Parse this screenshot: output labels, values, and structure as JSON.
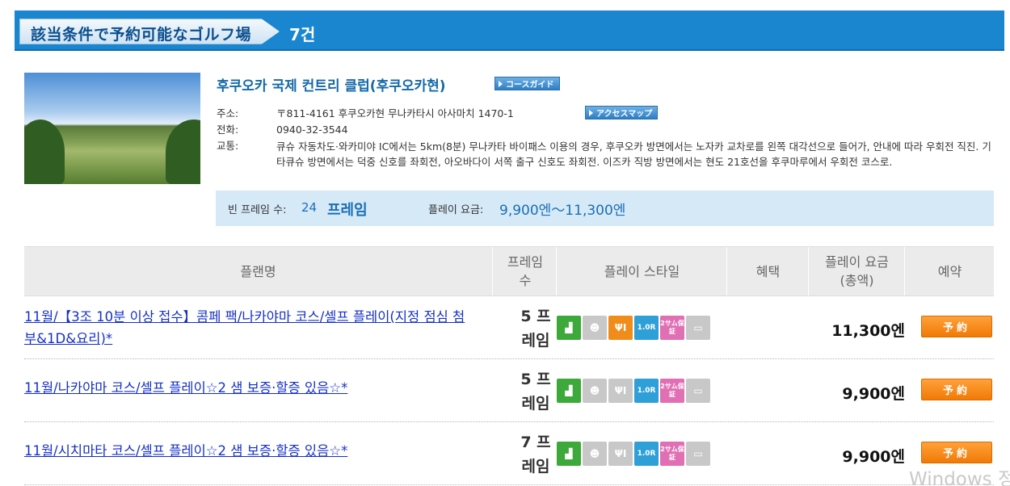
{
  "header": {
    "title": "該当条件で予約可能なゴルフ場",
    "count": "7건"
  },
  "course": {
    "name": "후쿠오카 국제 컨트리 클럽(후쿠오카현)",
    "course_guide_label": "コースガイド",
    "address_label": "주소:",
    "address": "〒811-4161 후쿠오카현 무나카타시 아사마치 1470-1",
    "access_map_label": "アクセスマップ",
    "phone_label": "전화:",
    "phone": "0940-32-3544",
    "access_label": "교통:",
    "access": "큐슈 자동차도·와카미야 IC에서는 5km(8분) 무나카타 바이패스 이용의 경우, 후쿠오카 방면에서는 노자카 교차로를 왼쪽 대각선으로 들어가, 안내에 따라 우회전 직진. 기타큐슈 방면에서는 덕중 신호를 좌회전, 아오바다이 서쪽 출구 신호도 좌회전. 이즈카 직방 방면에서는 현도 21호선을 후쿠마루에서 우회전 코스로.",
    "summary": {
      "frames_label": "빈 프레임 수:",
      "frames_value": "24",
      "frames_unit": "프레임",
      "fee_label": "플레이 요금:",
      "fee_value": "9,900엔～11,300엔"
    }
  },
  "table": {
    "headers": {
      "plan": "플랜명",
      "frames": "프레임\n수",
      "style": "플레이 스타일",
      "benefit": "혜택",
      "fee": "플레이 요금\n(총액)",
      "reserve": "예약"
    },
    "rows": [
      {
        "plan": "11월/【3조 10분 이상 접수】콤페 팩/나카야마 코스/셀프 플레이(지정 점심 첨부&1D&요리)*",
        "frames": "5 프\n레임",
        "price": "11,300엔",
        "book": "予約"
      },
      {
        "plan": "11월/나카야마 코스/셀프 플레이☆2 샘 보증·할증 있음☆*",
        "frames": "5 프\n레임",
        "price": "9,900엔",
        "book": "予約"
      },
      {
        "plan": "11월/시치마타 코스/셀프 플레이☆2 샘 보증·할증 있음☆*",
        "frames": "7 프\n레임",
        "price": "9,900엔",
        "book": "予約"
      }
    ],
    "style_icons": [
      {
        "name": "cart-icon",
        "color": "#3da93a"
      },
      {
        "name": "caddie-icon",
        "color": "#c8c8c8"
      },
      {
        "name": "meal-icon",
        "color": "#c8c8c8"
      },
      {
        "name": "one-round-icon",
        "color": "#2f9fd8"
      },
      {
        "name": "two-sum-guarantee-icon",
        "color": "#e06fb4"
      },
      {
        "name": "stay-icon",
        "color": "#c8c8c8"
      }
    ],
    "row1_meal_color": "#f08c1a",
    "one_round_text": "1.0R",
    "two_sum_text": "2サム保証"
  },
  "watermark": "Windows 정"
}
